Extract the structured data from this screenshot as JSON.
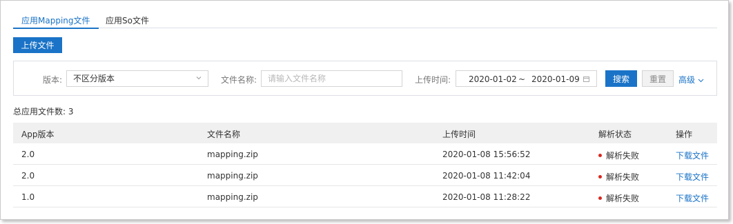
{
  "tabs": [
    {
      "label": "应用Mapping文件",
      "active": true
    },
    {
      "label": "应用So文件",
      "active": false
    }
  ],
  "toolbar": {
    "upload_label": "上传文件"
  },
  "filter": {
    "version_label": "版本:",
    "version_value": "不区分版本",
    "filename_label": "文件名称:",
    "filename_placeholder": "请输入文件名称",
    "upload_time_label": "上传时间:",
    "date_start": "2020-01-02",
    "date_sep": "~",
    "date_end": "2020-01-09",
    "search_label": "搜索",
    "reset_label": "重置",
    "advanced_label": "高级"
  },
  "summary": {
    "total_text": "总应用文件数: 3"
  },
  "table": {
    "headers": [
      "App版本",
      "文件名称",
      "上传时间",
      "解析状态",
      "操作"
    ],
    "rows": [
      {
        "version": "2.0",
        "filename": "mapping.zip",
        "time": "2020-01-08 15:56:52",
        "status": "解析失败",
        "action": "下载文件"
      },
      {
        "version": "2.0",
        "filename": "mapping.zip",
        "time": "2020-01-08 11:42:04",
        "status": "解析失败",
        "action": "下载文件"
      },
      {
        "version": "1.0",
        "filename": "mapping.zip",
        "time": "2020-01-08 11:28:22",
        "status": "解析失败",
        "action": "下载文件"
      }
    ]
  },
  "colors": {
    "accent": "#1a73c7",
    "status_fail": "#d9281e"
  },
  "icons": [
    "chevron-down-icon",
    "calendar-icon",
    "status-dot-icon"
  ]
}
